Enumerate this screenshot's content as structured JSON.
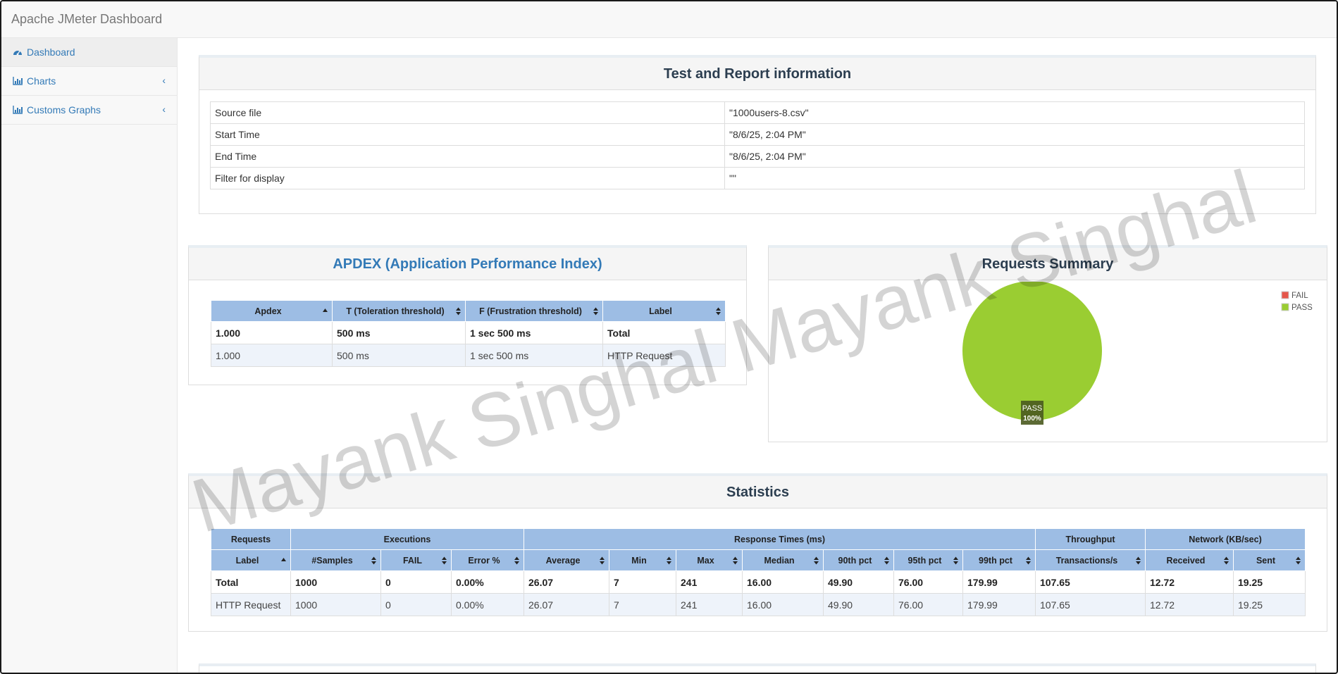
{
  "app": {
    "title": "Apache JMeter Dashboard"
  },
  "sidebar": {
    "items": [
      {
        "label": "Dashboard",
        "icon": "dashboard-icon"
      },
      {
        "label": "Charts",
        "icon": "bar-chart-icon"
      },
      {
        "label": "Customs Graphs",
        "icon": "bar-chart-icon"
      }
    ]
  },
  "test_info": {
    "title": "Test and Report information",
    "rows": [
      {
        "key": "Source file",
        "value": "\"1000users-8.csv\""
      },
      {
        "key": "Start Time",
        "value": "\"8/6/25, 2:04 PM\""
      },
      {
        "key": "End Time",
        "value": "\"8/6/25, 2:04 PM\""
      },
      {
        "key": "Filter for display",
        "value": "\"\""
      }
    ]
  },
  "apdex": {
    "title": "APDEX (Application Performance Index)",
    "headers": [
      "Apdex",
      "T (Toleration threshold)",
      "F (Frustration threshold)",
      "Label"
    ],
    "rows": [
      [
        "1.000",
        "500 ms",
        "1 sec 500 ms",
        "Total"
      ],
      [
        "1.000",
        "500 ms",
        "1 sec 500 ms",
        "HTTP Request"
      ]
    ]
  },
  "requests_summary": {
    "title": "Requests Summary",
    "legend": [
      {
        "label": "FAIL",
        "color": "#e5564b"
      },
      {
        "label": "PASS",
        "color": "#9acd32"
      }
    ],
    "slice_label": "PASS",
    "slice_pct": "100%"
  },
  "statistics": {
    "title": "Statistics",
    "groups": [
      "Requests",
      "Executions",
      "Response Times (ms)",
      "Throughput",
      "Network (KB/sec)"
    ],
    "headers": [
      "Label",
      "#Samples",
      "FAIL",
      "Error %",
      "Average",
      "Min",
      "Max",
      "Median",
      "90th pct",
      "95th pct",
      "99th pct",
      "Transactions/s",
      "Received",
      "Sent"
    ],
    "rows": [
      [
        "Total",
        "1000",
        "0",
        "0.00%",
        "26.07",
        "7",
        "241",
        "16.00",
        "49.90",
        "76.00",
        "179.99",
        "107.65",
        "12.72",
        "19.25"
      ],
      [
        "HTTP Request",
        "1000",
        "0",
        "0.00%",
        "26.07",
        "7",
        "241",
        "16.00",
        "49.90",
        "76.00",
        "179.99",
        "107.65",
        "12.72",
        "19.25"
      ]
    ]
  },
  "chart_data": {
    "type": "pie",
    "title": "Requests Summary",
    "categories": [
      "FAIL",
      "PASS"
    ],
    "values": [
      0,
      100
    ],
    "colors": [
      "#e5564b",
      "#9acd32"
    ],
    "legend": "top-right"
  },
  "watermark": {
    "text": "Mayank Singhal Mayank Singhal"
  }
}
